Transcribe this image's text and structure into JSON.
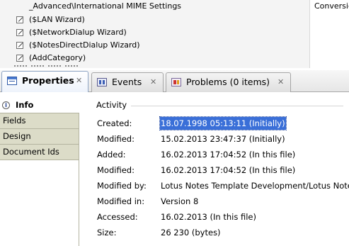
{
  "design_list": {
    "header_row": "_Advanced\\International MIME Settings",
    "right_column_header": "Conversic",
    "items": [
      {
        "label": "($LAN Wizard)"
      },
      {
        "label": "($NetworkDialup Wizard)"
      },
      {
        "label": "($NotesDirectDialup Wizard)"
      },
      {
        "label": "(AddCategory)"
      }
    ]
  },
  "tabs": [
    {
      "label": "Properties",
      "icon": "properties-icon",
      "active": true
    },
    {
      "label": "Events",
      "icon": "events-icon",
      "active": false
    },
    {
      "label": "Problems (0 items)",
      "icon": "problems-icon",
      "active": false
    }
  ],
  "close_glyph": "✕",
  "side_tabs": [
    {
      "label": "Info",
      "icon": "info-icon",
      "active": true
    },
    {
      "label": "Fields"
    },
    {
      "label": "Design"
    },
    {
      "label": "Document Ids"
    }
  ],
  "info_icon_glyph": "i",
  "activity": {
    "title": "Activity",
    "rows": [
      {
        "label": "Created:",
        "value": "18.07.1998 05:13:11 (Initially)",
        "selected": true
      },
      {
        "label": "Modified:",
        "value": "15.02.2013 23:47:37 (Initially)"
      },
      {
        "label": "Added:",
        "value": "16.02.2013 17:04:52 (In this file)"
      },
      {
        "label": "Modified:",
        "value": "16.02.2013 17:04:52 (In this file)"
      },
      {
        "label": "Modified by:",
        "value": "Lotus Notes Template Development/Lotus Notes"
      },
      {
        "label": "Modified in:",
        "value": "Version 8"
      },
      {
        "label": "Accessed:",
        "value": "16.02.2013 (In this file)"
      },
      {
        "label": "Size:",
        "value": "26 230 (bytes)"
      }
    ]
  },
  "colors": {
    "selection": "#3a6fd8",
    "side_tab_bg": "#dcdcc8",
    "active_tab_border": "#8ea4c4"
  }
}
